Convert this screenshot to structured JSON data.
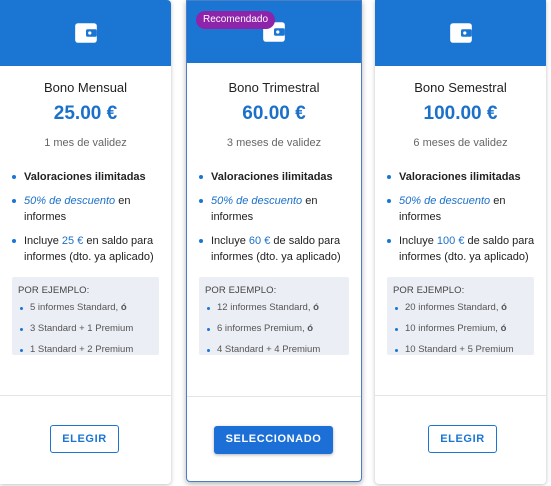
{
  "colors": {
    "accent": "#1b75d3",
    "badge": "#8e24aa",
    "example_bg": "#eceef6"
  },
  "cards": [
    {
      "icon": "wallet-icon",
      "name": "Bono Mensual",
      "price": "25.00 €",
      "validity": "1 mes de validez",
      "features": {
        "f1": "Valoraciones ilimitadas",
        "f2_highlight": "50% de descuento",
        "f2_rest": " en informes",
        "f3_pre": "Incluye ",
        "f3_amount": "25 €",
        "f3_post": " en saldo para informes (dto. ya aplicado)"
      },
      "example_title": "POR EJEMPLO:",
      "examples": [
        {
          "text": "5 informes Standard, ",
          "or": "ó"
        },
        {
          "text": "3 Standard + 1 Premium",
          "or": ""
        },
        {
          "text": "1 Standard + 2 Premium",
          "or": ""
        }
      ],
      "button": "ELEGIR"
    },
    {
      "icon": "wallet-icon",
      "badge": "Recomendado",
      "name": "Bono Trimestral",
      "price": "60.00 €",
      "validity": "3 meses de validez",
      "features": {
        "f1": "Valoraciones ilimitadas",
        "f2_highlight": "50% de descuento",
        "f2_rest": " en informes",
        "f3_pre": "Incluye ",
        "f3_amount": "60 €",
        "f3_post": " de saldo para informes (dto. ya aplicado)"
      },
      "example_title": "POR EJEMPLO:",
      "examples": [
        {
          "text": "12 informes Standard, ",
          "or": "ó"
        },
        {
          "text": "6 informes Premium, ",
          "or": "ó"
        },
        {
          "text": "4 Standard + 4 Premium",
          "or": ""
        }
      ],
      "button": "SELECCIONADO"
    },
    {
      "icon": "wallet-icon",
      "name": "Bono Semestral",
      "price": "100.00 €",
      "validity": "6 meses de validez",
      "features": {
        "f1": "Valoraciones ilimitadas",
        "f2_highlight": "50% de descuento",
        "f2_rest": " en informes",
        "f3_pre": "Incluye ",
        "f3_amount": "100 €",
        "f3_post": " de saldo para informes (dto. ya aplicado)"
      },
      "example_title": "POR EJEMPLO:",
      "examples": [
        {
          "text": "20 informes Standard, ",
          "or": "ó"
        },
        {
          "text": "10 informes Premium, ",
          "or": "ó"
        },
        {
          "text": "10 Standard + 5 Premium",
          "or": ""
        }
      ],
      "button": "ELEGIR"
    }
  ]
}
